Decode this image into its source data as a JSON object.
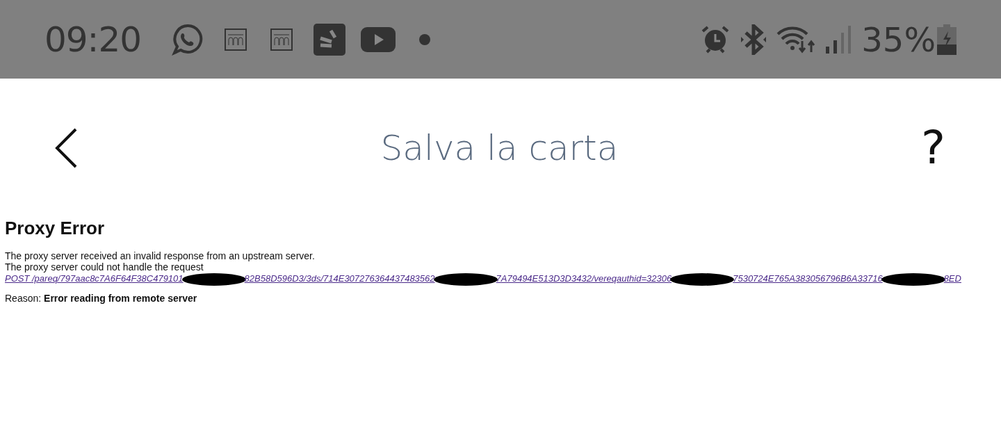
{
  "status_bar": {
    "time": "09:20",
    "battery": "35%"
  },
  "header": {
    "title": "Salva la carta",
    "help": "?"
  },
  "error": {
    "title": "Proxy Error",
    "lines": [
      "The proxy server received an invalid response from an upstream server.",
      "The proxy server could not handle the request"
    ],
    "link_segments": [
      "POST /pareq/797aac8c7A6F64F38C479101",
      "82B58D596D3/3ds/714E307276364437483562",
      "7A79494E513D3D3432/vereqauthid=32306",
      "7530724E765A383056796B6A33716",
      "8ED"
    ],
    "reason_label": "Reason:",
    "reason": "Error reading from remote server"
  }
}
